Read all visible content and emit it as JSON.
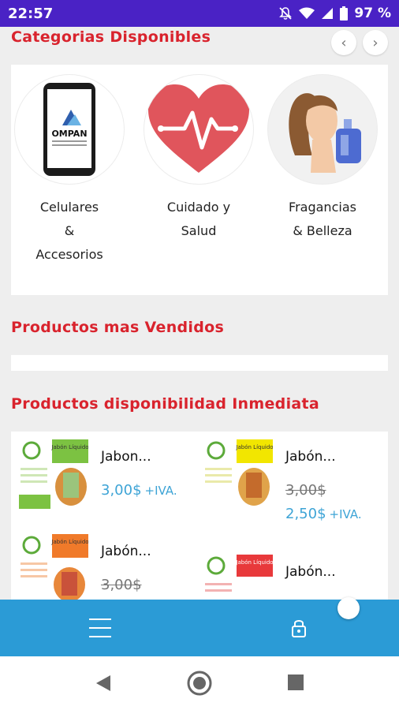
{
  "status_bar": {
    "time": "22:57",
    "battery": "97 %"
  },
  "categories": {
    "title": "Categorias Disponibles",
    "items": [
      {
        "label": "Celulares\n&\nAccesorios",
        "logo_text": "OMPAN"
      },
      {
        "label": "Cuidado y\nSalud"
      },
      {
        "label": "Fragancias\n& Belleza"
      }
    ]
  },
  "best_sellers": {
    "title": "Productos mas Vendidos"
  },
  "immediate": {
    "title": "Productos disponibilidad Inmediata",
    "products": [
      {
        "name": "Jabon...",
        "price": "3,00$",
        "iva": "+IVA.",
        "img_title": "Jabón Líquido",
        "accent": "#7cc242"
      },
      {
        "name": "Jabón...",
        "old_price": "3,00$",
        "price": "2,50$",
        "iva": "+IVA.",
        "img_title": "Jabón Líquido",
        "accent": "#f2e600"
      },
      {
        "name": "Jabón...",
        "old_price": "3,00$",
        "img_title": "Jabón Líquido",
        "accent": "#f07a2a"
      },
      {
        "name": "Jabón...",
        "img_title": "Jabón Líquido",
        "accent": "#e8393b"
      }
    ]
  },
  "colors": {
    "status_bar": "#4a22c5",
    "section_title": "#d9232d",
    "bottom_nav": "#2b9bd6",
    "price": "#3ea4d6"
  }
}
